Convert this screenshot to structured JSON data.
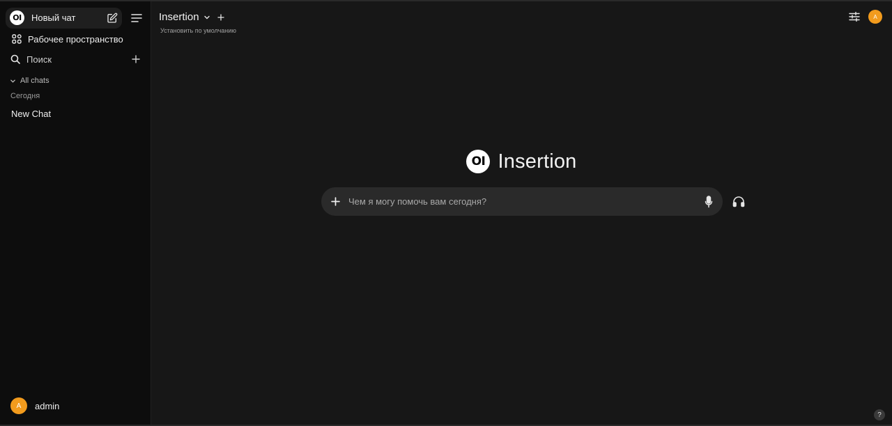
{
  "sidebar": {
    "logo_text": "OI",
    "new_chat_label": "Новый чат",
    "workspace_label": "Рабочее пространство",
    "search_label": "Поиск",
    "all_chats_label": "All chats",
    "section_date": "Сегодня",
    "chats": [
      {
        "title": "New Chat"
      }
    ],
    "user": {
      "avatar_initial": "A",
      "name": "admin"
    }
  },
  "header": {
    "model_name": "Insertion",
    "set_default_label": "Установить по умолчанию",
    "avatar_initial": "A"
  },
  "hero": {
    "logo_text": "OI",
    "title": "Insertion"
  },
  "composer": {
    "placeholder": "Чем я могу помочь вам сегодня?",
    "value": ""
  },
  "help": {
    "label": "?"
  },
  "colors": {
    "accent": "#f29b1d",
    "sidebar_bg": "#0d0d0d",
    "main_bg": "#171717",
    "input_bg": "#2a2a2a"
  },
  "icons": {
    "edit": "edit-icon",
    "menu": "menu-icon",
    "workspace": "grid-icon",
    "search": "search-icon",
    "plus": "plus-icon",
    "chevron": "chevron-down-icon",
    "settings": "sliders-icon",
    "mic": "microphone-icon",
    "headset": "headphones-icon"
  }
}
